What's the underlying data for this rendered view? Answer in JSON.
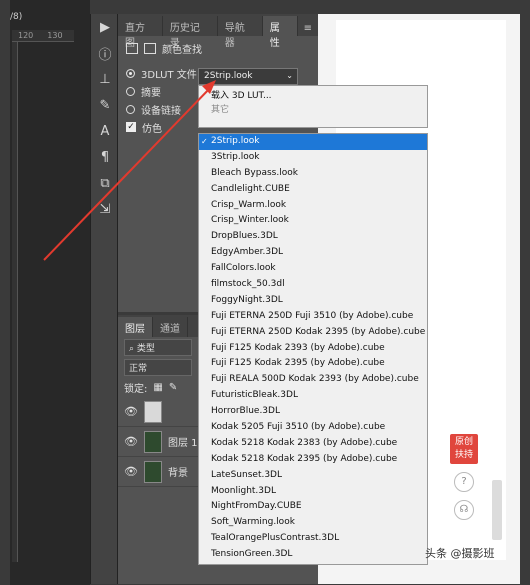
{
  "window": {
    "title_fragment": "/8)"
  },
  "ruler": {
    "ticks": [
      "120",
      "130"
    ]
  },
  "panel_tabs": [
    "直方图",
    "历史记录",
    "导航器",
    "属性"
  ],
  "properties": {
    "header_label": "颜色查找",
    "lut_label": "3DLUT 文件",
    "combo_value": "2Strip.look",
    "option_abstract": "摘要",
    "option_device": "设备链接",
    "option_dither": "仿色"
  },
  "popup_top": {
    "load": "载入 3D LUT...",
    "other": "其它"
  },
  "lut_list": [
    "2Strip.look",
    "3Strip.look",
    "Bleach Bypass.look",
    "Candlelight.CUBE",
    "Crisp_Warm.look",
    "Crisp_Winter.look",
    "DropBlues.3DL",
    "EdgyAmber.3DL",
    "FallColors.look",
    "filmstock_50.3dl",
    "FoggyNight.3DL",
    "Fuji ETERNA 250D Fuji 3510 (by Adobe).cube",
    "Fuji ETERNA 250D Kodak 2395 (by Adobe).cube",
    "Fuji F125 Kodak 2393 (by Adobe).cube",
    "Fuji F125 Kodak 2395 (by Adobe).cube",
    "Fuji REALA 500D Kodak 2393 (by Adobe).cube",
    "FuturisticBleak.3DL",
    "HorrorBlue.3DL",
    "Kodak 5205 Fuji 3510 (by Adobe).cube",
    "Kodak 5218 Kodak 2383 (by Adobe).cube",
    "Kodak 5218 Kodak 2395 (by Adobe).cube",
    "LateSunset.3DL",
    "Moonlight.3DL",
    "NightFromDay.CUBE",
    "Soft_Warming.look",
    "TealOrangePlusContrast.3DL",
    "TensionGreen.3DL"
  ],
  "selected_index": 0,
  "layers": {
    "tabs": [
      "图层",
      "通道"
    ],
    "filter_label": "类型",
    "blend_mode": "正常",
    "lock_label": "锁定:",
    "items": [
      {
        "name": ""
      },
      {
        "name": "图层 1"
      },
      {
        "name": "背景"
      }
    ]
  },
  "sidebar_badge": "原创\n扶持",
  "watermark": "头条 @摄影班",
  "colors": {
    "arrow": "#e23a2e",
    "selection": "#1e78d7"
  }
}
